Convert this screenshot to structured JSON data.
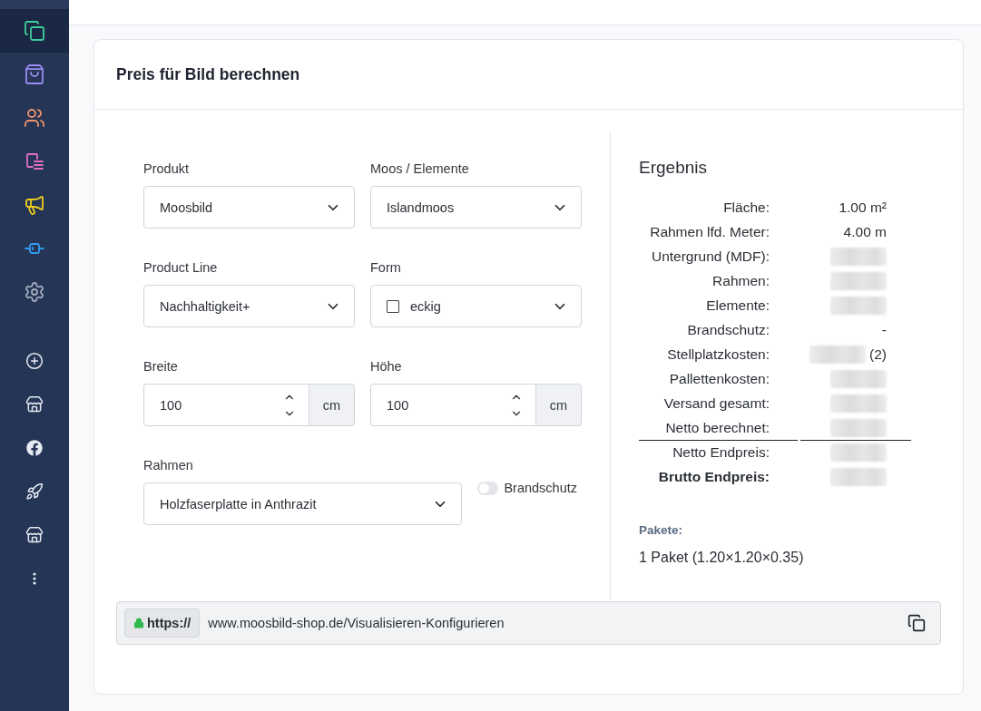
{
  "sidebar": {
    "primary": [
      {
        "selected": true,
        "color": "#3fcf9a"
      },
      {
        "selected": false,
        "color": "#9a8cf2"
      },
      {
        "selected": false,
        "color": "#f0926a"
      },
      {
        "selected": false,
        "color": "#e26fc6"
      },
      {
        "selected": false,
        "color": "#f2cf1d"
      },
      {
        "selected": false,
        "color": "#3399f0"
      },
      {
        "selected": false,
        "color": "#a3acbd"
      }
    ],
    "secondary": [
      {
        "selected": false
      },
      {
        "selected": false
      },
      {
        "selected": false
      },
      {
        "selected": false
      },
      {
        "selected": false
      },
      {
        "selected": false
      }
    ]
  },
  "card": {
    "title": "Preis für Bild berechnen"
  },
  "form": {
    "rows": [
      {
        "fields": [
          {
            "kind": "select",
            "label": "Produkt",
            "value": "Moosbild"
          },
          {
            "kind": "select",
            "label": "Moos / Elemente",
            "value": "Islandmoos"
          }
        ]
      },
      {
        "fields": [
          {
            "kind": "select",
            "label": "Product Line",
            "value": "Nachhaltigkeit+"
          },
          {
            "kind": "shape-select",
            "label": "Form",
            "value": "eckig"
          }
        ]
      },
      {
        "fields": [
          {
            "kind": "number",
            "label": "Breite",
            "value": "100",
            "unit": "cm"
          },
          {
            "kind": "number",
            "label": "Höhe",
            "value": "100",
            "unit": "cm"
          }
        ]
      },
      {
        "fields": [
          {
            "kind": "select",
            "label": "Rahmen",
            "value": "Holzfaserplatte in Anthrazit"
          },
          {
            "kind": "toggle",
            "label": "Brandschutz",
            "on": false
          }
        ]
      }
    ]
  },
  "results": {
    "title": "Ergebnis",
    "rows": [
      {
        "label": "Fläche:",
        "value": "1.00 m²",
        "redacted": false
      },
      {
        "label": "Rahmen lfd. Meter:",
        "value": "4.00 m",
        "redacted": false
      },
      {
        "label": "Untergrund (MDF):",
        "redacted": true
      },
      {
        "label": "Rahmen:",
        "redacted": true
      },
      {
        "label": "Elemente:",
        "redacted": true
      },
      {
        "label": "Brandschutz:",
        "value": "-",
        "redacted": false
      },
      {
        "label": "Stellplatzkosten:",
        "value": "(2)",
        "redacted": true
      },
      {
        "label": "Pallettenkosten:",
        "redacted": true
      },
      {
        "label": "Versand gesamt:",
        "redacted": true
      },
      {
        "label": "Netto berechnet:",
        "redacted": true
      }
    ],
    "totals": [
      {
        "label": "Netto Endpreis:",
        "redacted": true,
        "bold": false
      },
      {
        "label": "Brutto Endpreis:",
        "redacted": true,
        "bold": true
      }
    ],
    "packages": {
      "label": "Pakete:",
      "items": [
        "1 Paket (1.20×1.20×0.35)"
      ]
    }
  },
  "url_bar": {
    "protocol": "https://",
    "address": "www.moosbild-shop.de/Visualisieren-Konfigurieren"
  }
}
